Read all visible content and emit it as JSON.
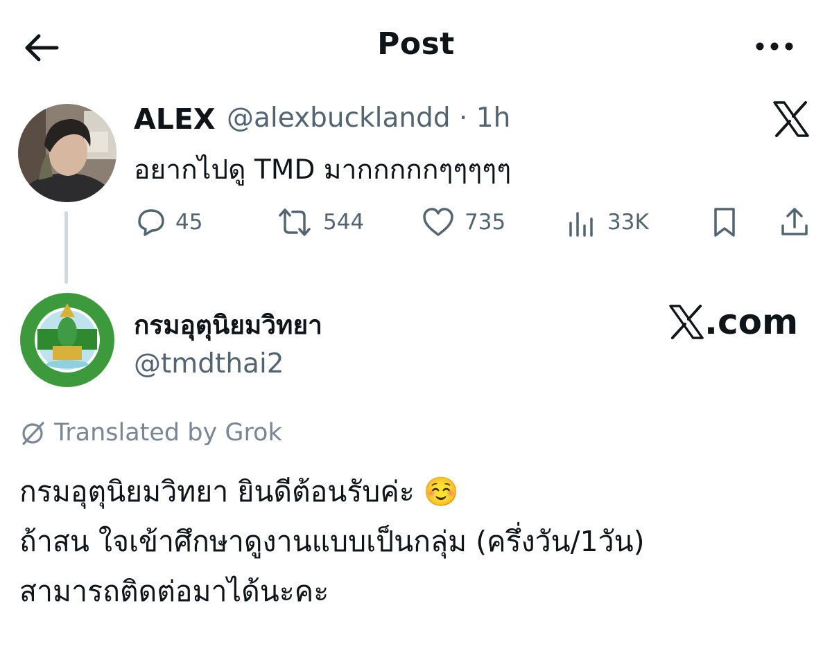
{
  "header": {
    "title": "Post"
  },
  "tweet": {
    "author_name": "ALEX",
    "handle_time": "@alexbucklandd · 1h",
    "text": "อยากไปดู TMD มากกกกกๆๆๆๆๆ",
    "replies": "45",
    "reposts": "544",
    "likes": "735",
    "views": "33K"
  },
  "reply": {
    "author_name": "กรมอุตุนิยมวิทยา",
    "handle": "@tmdthai2",
    "watermark": ".com",
    "translated_label": "Translated by Grok",
    "lines": [
      "กรมอุตุนิยมวิทยา ยินดีต้อนรับค่ะ ☺️",
      "ถ้าสน ใจเข้าศึกษาดูงานแบบเป็นกลุ่ม (ครึ่งวัน/1วัน)",
      "สามารถติดต่อมาได้นะคะ"
    ]
  },
  "colors": {
    "text": "#0f1419",
    "secondary": "#536471",
    "thread_line": "#cfd9de",
    "tmd_green": "#2e8b2e"
  },
  "icons": [
    "back-arrow-icon",
    "more-icon",
    "x-logo-icon",
    "reply-icon",
    "repost-icon",
    "like-icon",
    "views-icon",
    "bookmark-icon",
    "share-icon",
    "grok-icon"
  ]
}
